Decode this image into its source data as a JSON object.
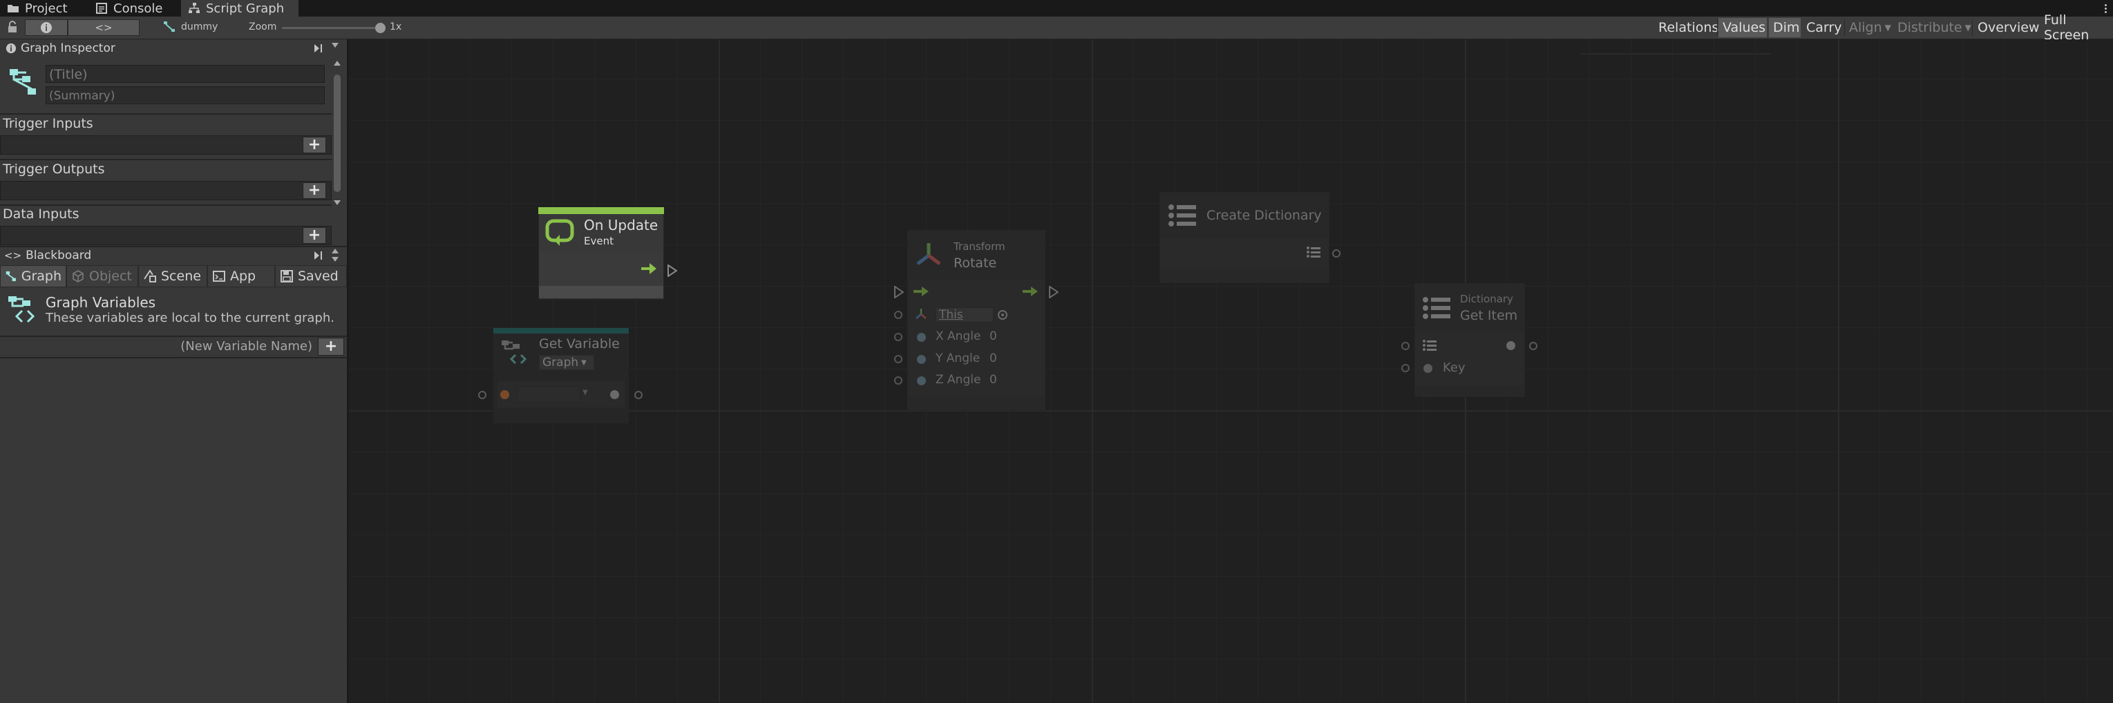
{
  "tabs": [
    {
      "label": "Project",
      "icon": "folder-icon"
    },
    {
      "label": "Console",
      "icon": "console-icon"
    },
    {
      "label": "Script Graph",
      "icon": "script-graph-icon"
    }
  ],
  "toolbar": {
    "graph_name": "dummy",
    "zoom_label": "Zoom",
    "zoom_value": "1x",
    "zoom_level": 1,
    "buttons": [
      {
        "label": "Relations",
        "state": "normal"
      },
      {
        "label": "Values",
        "state": "active"
      },
      {
        "label": "Dim",
        "state": "active"
      },
      {
        "label": "Carry",
        "state": "normal"
      },
      {
        "label": "Align",
        "state": "disabled"
      },
      {
        "label": "Distribute",
        "state": "disabled"
      },
      {
        "label": "Overview",
        "state": "normal"
      },
      {
        "label": "Full Screen",
        "state": "normal"
      }
    ]
  },
  "inspector": {
    "header": "Graph Inspector",
    "title_placeholder": "(Title)",
    "summary_placeholder": "(Summary)",
    "sections": [
      "Trigger Inputs",
      "Trigger Outputs",
      "Data Inputs"
    ]
  },
  "blackboard": {
    "header": "Blackboard",
    "tabs": [
      {
        "label": "Graph",
        "state": "active"
      },
      {
        "label": "Object",
        "state": "dim"
      },
      {
        "label": "Scene",
        "state": "normal"
      },
      {
        "label": "App",
        "state": "normal"
      },
      {
        "label": "Saved",
        "state": "normal"
      }
    ],
    "variables_title": "Graph Variables",
    "variables_desc": "These variables are local to the current graph.",
    "new_variable_placeholder": "(New Variable Name)"
  },
  "nodes": {
    "on_update": {
      "title": "On Update",
      "subtitle": "Event",
      "accent": "#8bc34a"
    },
    "get_variable": {
      "title": "Get Variable",
      "kind": "Graph",
      "accent": "#1e5e5c"
    },
    "rotate": {
      "category": "Transform",
      "title": "Rotate",
      "target": "This",
      "x_label": "X Angle",
      "x_value": "0",
      "y_label": "Y Angle",
      "y_value": "0",
      "z_label": "Z Angle",
      "z_value": "0"
    },
    "create_dictionary": {
      "title": "Create Dictionary"
    },
    "get_item": {
      "category": "Dictionary",
      "title": "Get Item",
      "key_label": "Key"
    }
  },
  "colors": {
    "flow_green": "#8bc34a",
    "accent_teal": "#4fc3c0",
    "object_orange": "#c0703a"
  }
}
